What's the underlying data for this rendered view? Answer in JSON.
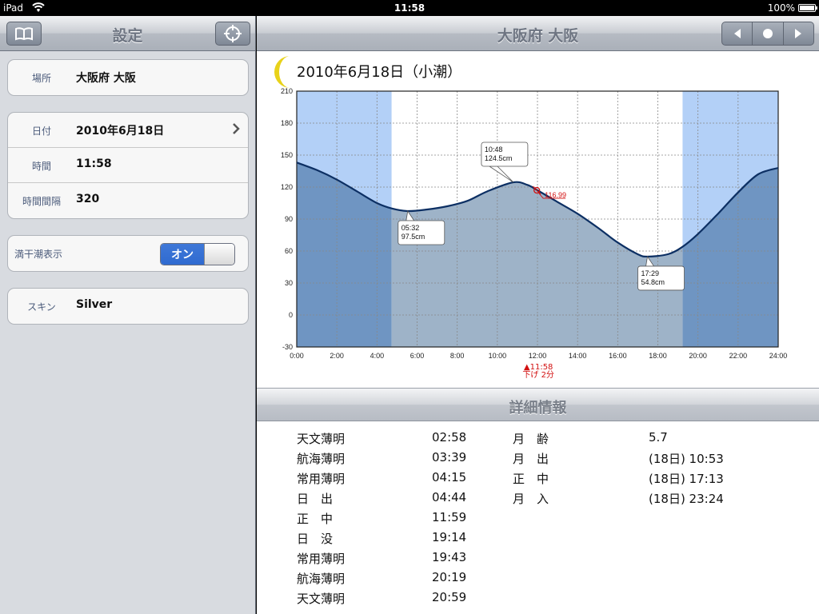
{
  "status_bar": {
    "carrier": "iPad",
    "time": "11:58",
    "battery": "100%"
  },
  "sidebar": {
    "title": "設定",
    "location": {
      "label": "場所",
      "value": "大阪府 大阪"
    },
    "date": {
      "label": "日付",
      "value": "2010年6月18日"
    },
    "time": {
      "label": "時間",
      "value": "11:58"
    },
    "interval": {
      "label": "時間間隔",
      "value": "320"
    },
    "tide_display": {
      "label": "満干潮表示",
      "toggle": "オン"
    },
    "skin": {
      "label": "スキン",
      "value": "Silver"
    }
  },
  "main": {
    "title": "大阪府 大阪",
    "chart_title": "2010年6月18日（小潮）",
    "details_title": "詳細情報"
  },
  "chart_data": {
    "type": "area",
    "x_unit": "hour",
    "xlim": [
      0,
      24
    ],
    "ylim": [
      -30,
      210
    ],
    "x_ticks": [
      "0:00",
      "2:00",
      "4:00",
      "6:00",
      "8:00",
      "10:00",
      "12:00",
      "14:00",
      "16:00",
      "18:00",
      "20:00",
      "22:00",
      "24:00"
    ],
    "y_ticks": [
      "210",
      "180",
      "150",
      "120",
      "90",
      "60",
      "30",
      "0",
      "-30"
    ],
    "series": [
      {
        "x": [
          0,
          1,
          2,
          3,
          4,
          4.73,
          5.53,
          6.5,
          7.5,
          8.5,
          9.5,
          10.8,
          11.5,
          12.0,
          13,
          14,
          15,
          16,
          17,
          17.48,
          18.5,
          19.23,
          20,
          21,
          22,
          23,
          24
        ],
        "y": [
          143,
          136,
          127,
          116,
          105,
          100,
          97.5,
          99,
          102,
          107,
          116,
          124.5,
          122,
          116.99,
          106,
          95,
          82,
          68,
          57,
          54.8,
          57,
          64,
          76,
          95,
          115,
          132,
          138
        ]
      }
    ],
    "daylight": {
      "sunrise": "04:44",
      "sunset": "19:14",
      "sunrise_h": 4.733,
      "sunset_h": 19.233
    },
    "annotations": [
      {
        "time": "05:32",
        "height": "97.5cm",
        "x": 5.533,
        "y": 97.5
      },
      {
        "time": "10:48",
        "height": "124.5cm",
        "x": 10.8,
        "y": 124.5
      },
      {
        "time": "17:29",
        "height": "54.8cm",
        "x": 17.483,
        "y": 54.8
      }
    ],
    "current": {
      "x": 11.967,
      "y": 116.99,
      "value_label": "116.99",
      "time_label": "▲11:58",
      "trend_label": "下げ 2分"
    }
  },
  "details_left": [
    {
      "name": "天文薄明",
      "time": "02:58"
    },
    {
      "name": "航海薄明",
      "time": "03:39"
    },
    {
      "name": "常用薄明",
      "time": "04:15"
    },
    {
      "name": "日　出",
      "time": "04:44"
    },
    {
      "name": "正　中",
      "time": "11:59"
    },
    {
      "name": "日　没",
      "time": "19:14"
    },
    {
      "name": "常用薄明",
      "time": "19:43"
    },
    {
      "name": "航海薄明",
      "time": "20:19"
    },
    {
      "name": "天文薄明",
      "time": "20:59"
    }
  ],
  "details_right": [
    {
      "name": "月　齢",
      "value": "5.7"
    },
    {
      "name": "月　出",
      "value": "(18日) 10:53"
    },
    {
      "name": "正　中",
      "value": "(18日) 17:13"
    },
    {
      "name": "月　入",
      "value": "(18日) 23:24"
    }
  ]
}
